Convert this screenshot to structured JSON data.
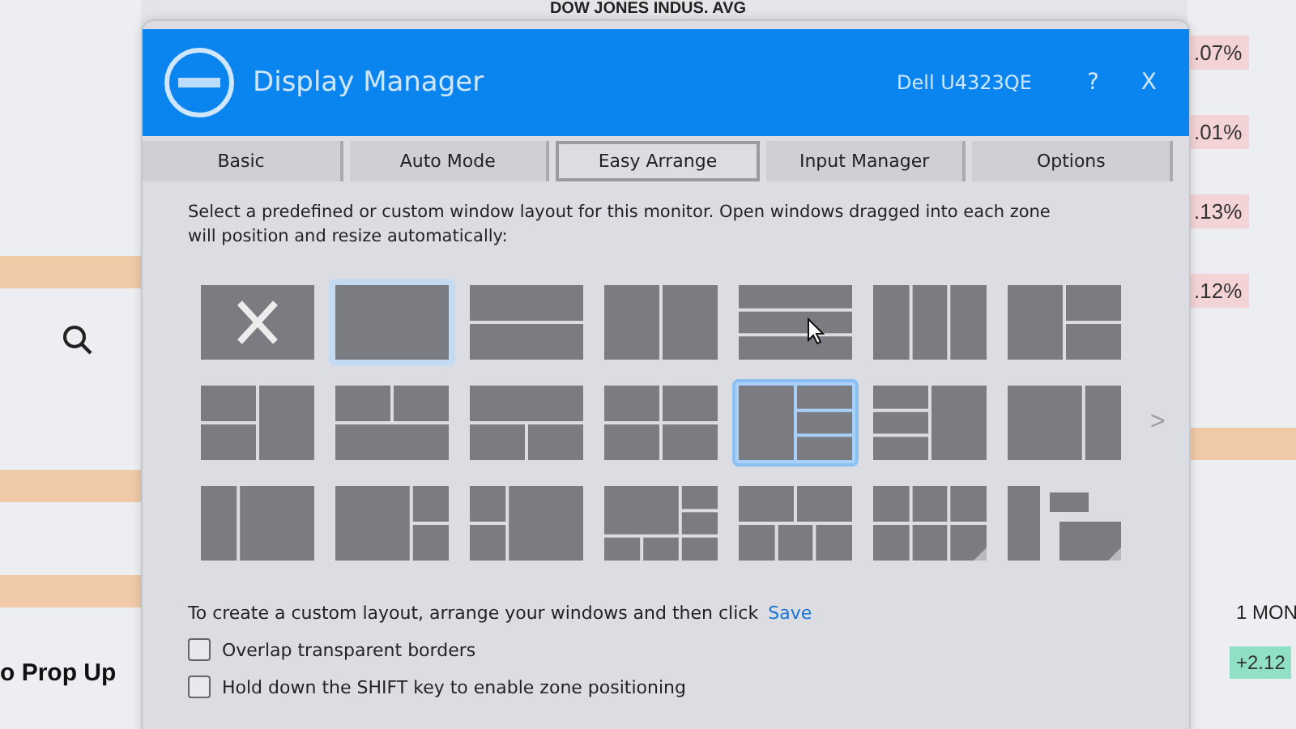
{
  "background": {
    "heading": "DOW JONES INDUS. AVG",
    "headline": "o Prop Up",
    "changes": [
      {
        "text": ".07%",
        "color": "#f3d3d6"
      },
      {
        "text": ".01%",
        "color": "#f3d3d6"
      },
      {
        "text": ".13%",
        "color": "#f3d3d6"
      },
      {
        "text": ".12%",
        "color": "#f3d3d6"
      }
    ],
    "period": "1 MON",
    "change": {
      "text": "+2.12",
      "color": "#8fe0c4"
    }
  },
  "window": {
    "title": "Display Manager",
    "monitor": "Dell U4323QE",
    "help": "?",
    "close": "X"
  },
  "tabs": [
    {
      "label": "Basic",
      "selected": false
    },
    {
      "label": "Auto Mode",
      "selected": false
    },
    {
      "label": "Easy Arrange",
      "selected": true
    },
    {
      "label": "Input Manager",
      "selected": false
    },
    {
      "label": "Options",
      "selected": false
    }
  ],
  "intro": "Select a predefined or custom window layout for this monitor.  Open windows dragged into each zone will position and resize automatically:",
  "layouts": [
    {
      "kind": "none",
      "selected": false,
      "current": false
    },
    {
      "kind": "layout",
      "selected": false,
      "current": true
    },
    {
      "kind": "layout",
      "selected": false,
      "current": false
    },
    {
      "kind": "layout",
      "selected": false,
      "current": false
    },
    {
      "kind": "layout",
      "selected": false,
      "current": false
    },
    {
      "kind": "layout",
      "selected": false,
      "current": false
    },
    {
      "kind": "layout",
      "selected": false,
      "current": false
    },
    {
      "kind": "layout",
      "selected": false,
      "current": false
    },
    {
      "kind": "layout",
      "selected": false,
      "current": false
    },
    {
      "kind": "layout",
      "selected": false,
      "current": false
    },
    {
      "kind": "layout",
      "selected": false,
      "current": false
    },
    {
      "kind": "layout",
      "selected": true,
      "current": false
    },
    {
      "kind": "layout",
      "selected": false,
      "current": false
    },
    {
      "kind": "layout",
      "selected": false,
      "current": false
    },
    {
      "kind": "layout",
      "selected": false,
      "current": false
    },
    {
      "kind": "layout",
      "selected": false,
      "current": false
    },
    {
      "kind": "layout",
      "selected": false,
      "current": false
    },
    {
      "kind": "layout",
      "selected": false,
      "current": false
    },
    {
      "kind": "layout",
      "selected": false,
      "current": false
    },
    {
      "kind": "layout",
      "selected": false,
      "current": false
    },
    {
      "kind": "layout",
      "selected": false,
      "current": false
    }
  ],
  "next": ">",
  "custom_note": "To create a custom layout, arrange your windows and then click",
  "save_link": "Save",
  "options": [
    {
      "label": "Overlap transparent borders",
      "checked": false
    },
    {
      "label": "Hold down the SHIFT key to enable zone positioning",
      "checked": false
    }
  ]
}
